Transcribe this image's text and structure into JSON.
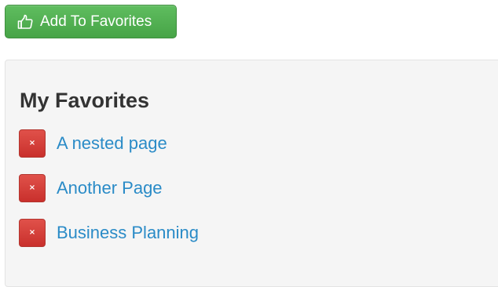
{
  "toolbar": {
    "add_favorites_label": "Add To Favorites",
    "add_favorites_icon": "thumbs-up-icon",
    "button_color": "#47a447"
  },
  "favorites": {
    "title": "My Favorites",
    "remove_glyph": "×",
    "remove_color": "#d9534f",
    "link_color": "#2a8bc7",
    "items": [
      {
        "label": "A nested page"
      },
      {
        "label": "Another Page"
      },
      {
        "label": "Business Planning"
      }
    ]
  }
}
